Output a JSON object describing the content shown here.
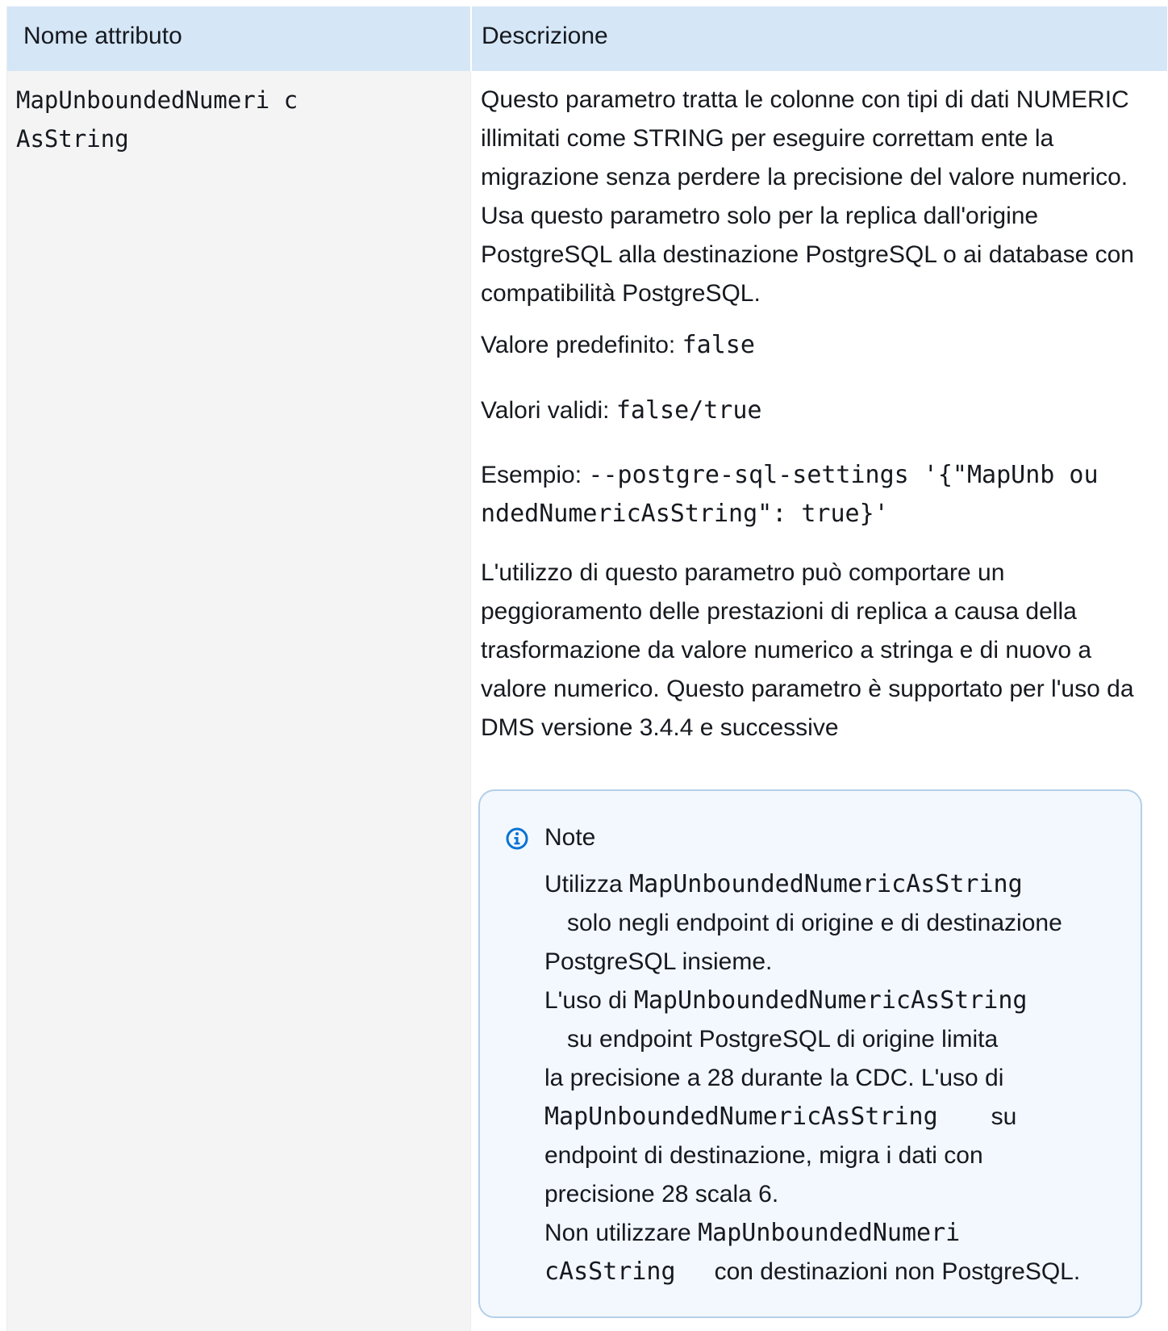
{
  "table": {
    "headers": {
      "attribute": "Nome attributo",
      "description": "Descrizione"
    },
    "row": {
      "attribute_name": "MapUnboundedNumeri cAsString",
      "description": "Questo parametro tratta le colonne con tipi di dati NUMERIC illimitati come STRING per eseguire correttam ente la migrazione senza perdere la precisione del valore numerico. Usa questo parametro solo per la replica dall'origine PostgreSQL alla destinazione PostgreSQL o ai database con compatibilità PostgreSQL.",
      "default_label": "Valore predefinito: ",
      "default_value": "false",
      "valid_label": "Valori validi: ",
      "valid_value": "false/true",
      "example_label": "Esempio: ",
      "example_value": "--postgre-sql-settings '{\"MapUnb oundedNumericAsString\": true}'",
      "performance": "L'utilizzo di questo parametro può comportare un peggioramento delle prestazioni di replica a causa della trasformazione da valore numerico a stringa e di nuovo a valore numerico. Questo parametro è supportato per l'uso da DMS versione 3.4.4 e successive"
    }
  },
  "note": {
    "icon": "info-icon",
    "title": "Note",
    "item1_prefix": "Utilizza ",
    "item1_code": "MapUnboundedNumericAsString",
    "item1_suffix_line1": "solo negli endpoint di origine e di destinazione",
    "item1_suffix_line2": "PostgreSQL insieme.",
    "item2_prefix": "L'uso di ",
    "item2_code": "MapUnboundedNumericAsString",
    "item2_line2": "su endpoint PostgreSQL di origine limita",
    "item2_line3": "la precisione a 28 durante la CDC. L'uso di",
    "item2_code2": "MapUnboundedNumericAsString",
    "item2_line4_suffix": "su",
    "item2_line5": "endpoint di destinazione, migra i dati con",
    "item2_line6": "precisione 28 scala 6.",
    "item3_prefix": "Non utilizzare ",
    "item3_code_part1": "MapUnboundedNumeri",
    "item3_code_part2": "cAsString",
    "item3_suffix": "con destinazioni non PostgreSQL."
  },
  "colors": {
    "header_bg": "#d5e6f6",
    "note_bg": "#f2f8fd",
    "note_border": "#b3cfe9",
    "icon_color": "#0972d3"
  }
}
